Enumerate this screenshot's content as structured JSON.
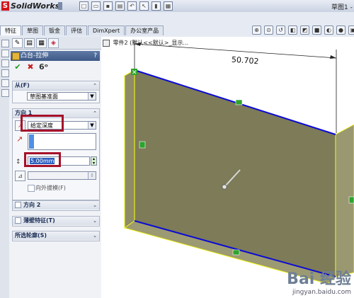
{
  "app": {
    "name": "SolidWorks",
    "document_title": "草图1 -"
  },
  "command_tabs": [
    "特征",
    "草图",
    "钣金",
    "评估",
    "DimXpert",
    "办公室产品"
  ],
  "breadcrumb": "零件2 (默认<<默认>_显示...",
  "property_manager": {
    "title": "凸台-拉伸",
    "help": "?",
    "from": {
      "header": "从(F)",
      "value": "草图基准面"
    },
    "direction1": {
      "header": "方向 1",
      "end_condition": "给定深度",
      "depth": "5.00mm",
      "draft_label": "向外拔模(F)"
    },
    "collapsed_groups": [
      "方向 2",
      "薄壁特征(T)",
      "所选轮廓(S)"
    ]
  },
  "viewport": {
    "dimension_value": "50.702",
    "accent_color": "#f1f51a",
    "face_color": "#7d7b58",
    "edge_color": "#0b0bd4"
  },
  "watermark": {
    "main": "Bai 经验",
    "sub": "jingyan.baidu.com"
  }
}
